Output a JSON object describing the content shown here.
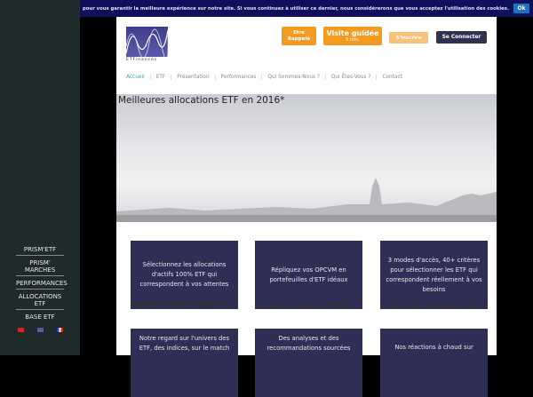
{
  "cookie": {
    "text": "pour vous garantir la meilleure expérience sur notre site. Si vous continuez à utiliser ce dernier, nous considérerons que vous acceptez l'utilisation des cookies.",
    "ok": "Ok"
  },
  "sidebar": {
    "items": [
      "PRISM'ETF",
      "PRISM' MARCHES",
      "PERFORMANCES",
      "ALLOCATIONS ETF",
      "BASE ETF"
    ],
    "flags": [
      "zh",
      "en",
      "fr"
    ]
  },
  "logo": {
    "text": "ETFinances"
  },
  "header": {
    "rappel": "Etre Rappelé",
    "visite": "Visite guidée",
    "visite_sub": "5 min.",
    "inscrire": "S'inscrire",
    "connecter": "Se Connecter"
  },
  "nav": [
    "Accueil",
    "ETF",
    "Présentation",
    "Performances",
    "Qui Sommes-Nous ?",
    "Qui Êtes-Vous ?",
    "Contact"
  ],
  "hero": {
    "title": "Meilleures allocations ETF en 2016*"
  },
  "cards": [
    {
      "text": "Sélectionnez les allocations d'actifs 100% ETF qui correspondent à vos attentes",
      "title": "PORTEFEUILLES ETF"
    },
    {
      "text": "Répliquez vos OPCVM en portefeuilles d'ETF idéaux",
      "title": "REPLICATION OPCVM"
    },
    {
      "text": "3 modes d'accès, 40+ critères pour sélectionner les ETF qui correspondent réellement à vos besoins",
      "title": "BASE DE DONNEES ETF"
    },
    {
      "text": "Notre regard sur l'univers des ETF, des indices, sur le match"
    },
    {
      "text": "Des analyses et des recommandations sourcées"
    },
    {
      "text": "Nos réactions à chaud sur"
    }
  ]
}
